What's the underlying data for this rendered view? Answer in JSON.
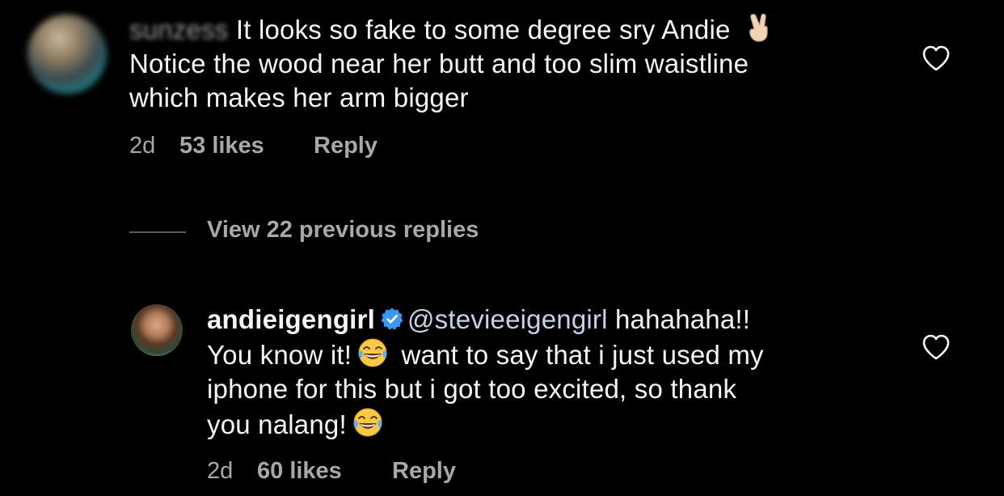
{
  "comments": [
    {
      "author": "sunzess",
      "text": "It looks so fake to some degree sry Andie",
      "text_line2": "Notice the wood near her butt and too slim waistline",
      "text_line3": "which makes her arm bigger",
      "emoji": "victory-hand-emoji",
      "time": "2d",
      "likes": "53 likes",
      "reply_label": "Reply"
    },
    {
      "author": "andieigengirl",
      "verified": true,
      "mention": "@stevieeigengirl",
      "text_part1": " hahahaha!!",
      "text_part2": "You know it!",
      "text_part3": " want to say that i just used my",
      "text_part4": "iphone for this but i got too excited, so thank",
      "text_part5": "you nalang!",
      "emoji": "face-with-tears-of-joy-emoji",
      "time": "2d",
      "likes": "60 likes",
      "reply_label": "Reply"
    }
  ],
  "view_replies": {
    "label": "View 22 previous replies"
  },
  "colors": {
    "background": "#000000",
    "text_primary": "#f5f5f5",
    "text_secondary": "#a8a8a8",
    "verified_blue": "#3897f0"
  },
  "icons": {
    "like": "heart-outline-icon",
    "verified": "verified-badge-icon"
  }
}
